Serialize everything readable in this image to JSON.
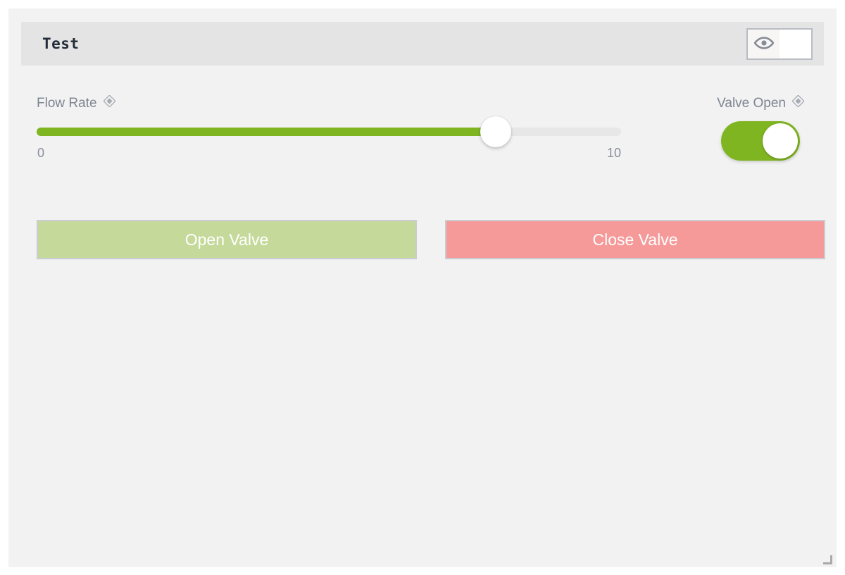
{
  "window": {
    "title": "Test",
    "background": "#f2f2f2",
    "header_background": "#e4e4e4"
  },
  "header": {
    "visibility_group": {
      "eye_icon": "eye-icon",
      "left_label": "",
      "right_label": ""
    }
  },
  "controls": {
    "slider": {
      "label": "Flow Rate",
      "binding_icon": "diamond-binding-icon",
      "min_label": "0",
      "max_label": "10",
      "min": 0,
      "max": 10,
      "value": 7.8,
      "fill_percent": 78.5,
      "fill_color": "#80b522",
      "track_color": "#e7e7e7",
      "thumb_color": "#ffffff"
    },
    "toggle": {
      "label": "Valve Open",
      "binding_icon": "diamond-binding-icon",
      "state": "on",
      "on_color": "#80b522",
      "knob_color": "#ffffff"
    }
  },
  "actions": [
    {
      "label": "Open Valve",
      "color": "#c5d99b",
      "text_color": "#ffffff"
    },
    {
      "label": "Close Valve",
      "color": "#f59a99",
      "text_color": "#ffffff"
    }
  ]
}
